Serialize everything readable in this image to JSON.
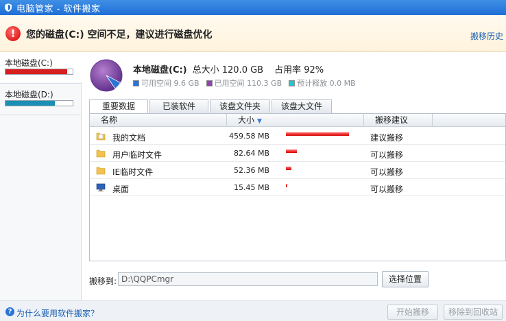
{
  "window": {
    "title": "电脑管家 - 软件搬家",
    "app_icon": "shield-icon"
  },
  "banner": {
    "icon": "warning-icon",
    "message": "您的磁盘(C:) 空间不足，建议进行磁盘优化",
    "history_link": "搬移历史"
  },
  "sidebar": {
    "disks": [
      {
        "label": "本地磁盘(C:)",
        "usage_fraction": 0.92,
        "bar_color": "#d81e1e",
        "selected": true
      },
      {
        "label": "本地磁盘(D:)",
        "usage_fraction": 0.73,
        "bar_color": "#1a8fb3",
        "selected": false
      }
    ]
  },
  "disk_info": {
    "name": "本地磁盘(C:)",
    "total": "总大小 120.0 GB",
    "usage": "占用率 92%",
    "usage_fraction": 0.92,
    "legend": [
      {
        "label": "可用空间 9.6 GB",
        "color": "#2a74d8"
      },
      {
        "label": "已用空间 110.3 GB",
        "color": "#8e44ad"
      },
      {
        "label": "预计释放 0.0 MB",
        "color": "#22c4d0"
      }
    ]
  },
  "tabs": [
    {
      "label": "重要数据",
      "active": true
    },
    {
      "label": "已装软件",
      "active": false
    },
    {
      "label": "该盘文件夹",
      "active": false
    },
    {
      "label": "该盘大文件",
      "active": false
    }
  ],
  "table": {
    "columns": {
      "name": "名称",
      "size": "大小",
      "advice": "搬移建议"
    },
    "sort_icon": "sort-desc-icon",
    "rows": [
      {
        "icon": "documents-folder-icon",
        "name": "我的文档",
        "size": "459.58 MB",
        "size_fraction": 1.0,
        "advice": "建议搬移"
      },
      {
        "icon": "folder-icon",
        "name": "用户临时文件",
        "size": "82.64 MB",
        "size_fraction": 0.17,
        "advice": "可以搬移"
      },
      {
        "icon": "folder-icon",
        "name": "IE临时文件",
        "size": "52.36 MB",
        "size_fraction": 0.09,
        "advice": "可以搬移"
      },
      {
        "icon": "desktop-icon",
        "name": "桌面",
        "size": "15.45 MB",
        "size_fraction": 0.02,
        "advice": "可以搬移"
      }
    ]
  },
  "move_to": {
    "label": "搬移到:",
    "path": "D:\\QQPCmgr",
    "choose_button": "选择位置"
  },
  "footer": {
    "help_icon": "help-icon",
    "help_link": "为什么要用软件搬家？",
    "start_button": "开始搬移",
    "recycle_button": "移除到回收站"
  }
}
